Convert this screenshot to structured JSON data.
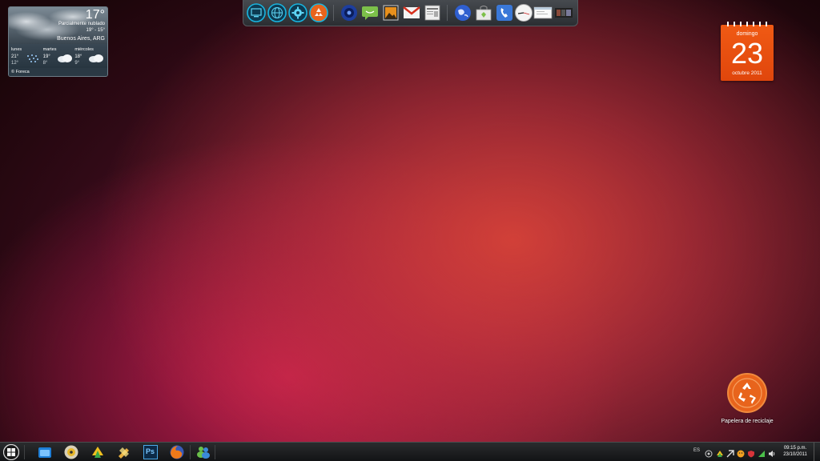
{
  "weather": {
    "temperature": "17°",
    "condition": "Parcialmente nublado",
    "range": "19° - 15°",
    "city": "Buenos Aires, ARG",
    "forecast": [
      {
        "day": "lunes",
        "high": "21°",
        "low": "12°",
        "icon": "rain-icon"
      },
      {
        "day": "martes",
        "high": "19°",
        "low": "8°",
        "icon": "cloud-icon"
      },
      {
        "day": "miércoles",
        "high": "18°",
        "low": "9°",
        "icon": "cloud-icon"
      }
    ],
    "credit": "© Foreca"
  },
  "dock": {
    "items": [
      {
        "name": "computer-icon"
      },
      {
        "name": "globe-icon"
      },
      {
        "name": "settings-icon"
      },
      {
        "name": "recycle-icon"
      },
      {
        "name": "media-player-icon"
      },
      {
        "name": "chat-icon"
      },
      {
        "name": "photos-icon"
      },
      {
        "name": "gmail-icon"
      },
      {
        "name": "news-icon"
      },
      {
        "name": "browser-globe-icon"
      },
      {
        "name": "shopping-bag-icon"
      },
      {
        "name": "phone-icon"
      },
      {
        "name": "clock-icon"
      },
      {
        "name": "window-icon"
      },
      {
        "name": "film-icon"
      }
    ]
  },
  "calendar": {
    "day_of_week": "domingo",
    "day": "23",
    "month_year": "octubre 2011"
  },
  "recycle_bin": {
    "label": "Papelera de reciclaje"
  },
  "taskbar": {
    "pinned": [
      {
        "name": "explorer-icon"
      },
      {
        "name": "media-disc-icon"
      },
      {
        "name": "downloader-icon"
      },
      {
        "name": "tools-icon"
      },
      {
        "name": "photoshop-icon",
        "text": "Ps"
      },
      {
        "name": "firefox-icon"
      },
      {
        "name": "messenger-icon"
      }
    ],
    "language": "ES",
    "clock_time": "09:15 p.m.",
    "clock_date": "23/10/2011"
  },
  "colors": {
    "accent_orange": "#f05a14",
    "wallpaper_red": "#d64238",
    "wallpaper_magenta": "#c81e50"
  }
}
